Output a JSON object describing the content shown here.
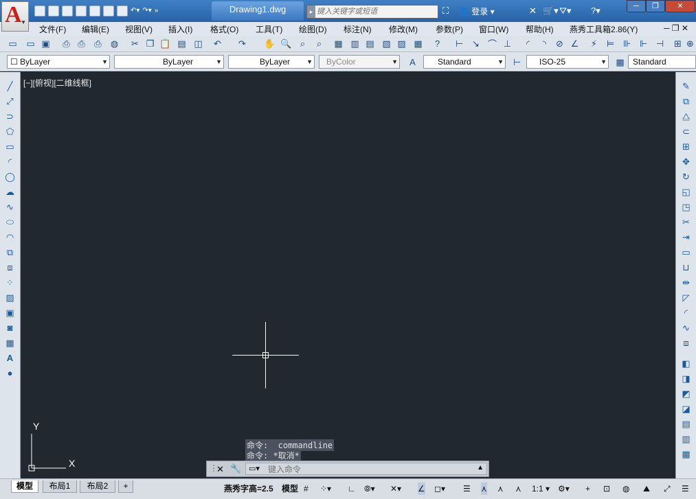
{
  "app": {
    "doc_tab": "Drawing1.dwg",
    "search_placeholder": "键入关键字或短语",
    "login": "登录",
    "logo": "A"
  },
  "menu": [
    "文件(F)",
    "编辑(E)",
    "视图(V)",
    "插入(I)",
    "格式(O)",
    "工具(T)",
    "绘图(D)",
    "标注(N)",
    "修改(M)",
    "参数(P)",
    "窗口(W)",
    "帮助(H)",
    "燕秀工具箱2.86(Y)"
  ],
  "props": {
    "layer": "ByLayer",
    "linetype": "ByLayer",
    "lineweight": "ByLayer",
    "color": "ByColor",
    "text_style": "Standard",
    "dim_style": "ISO-25",
    "table_style": "Standard"
  },
  "viewport": {
    "label": "[−][俯视][二维线框]",
    "ucs_x": "X",
    "ucs_y": "Y"
  },
  "command": {
    "history": [
      "命令: _commandline",
      "命令: *取消*"
    ],
    "placeholder": "键入命令"
  },
  "layout_tabs": [
    "模型",
    "布局1",
    "布局2"
  ],
  "status": {
    "font_height": "燕秀字高=2.5",
    "model": "模型",
    "scale": "1:1"
  }
}
